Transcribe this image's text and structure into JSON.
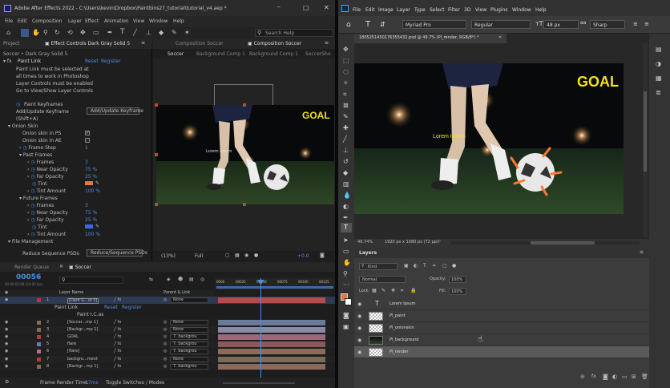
{
  "ae": {
    "title": "Adobe After Effects 2022 - C:\\Users\\kevin\\Dropbox\\Paintbins27_tutorial\\tutorial_v4.aep *",
    "menu": [
      "File",
      "Edit",
      "Composition",
      "Layer",
      "Effect",
      "Animation",
      "View",
      "Window",
      "Help"
    ],
    "search_help": "Search Help",
    "project_tab": "Project",
    "effect_controls_tab": "Effect Controls Dark Gray Solid 5",
    "fx_header": "Soccer • Dark Gray Solid 5",
    "fx_name": "Paint Link",
    "reset": "Reset",
    "register": "Register",
    "info_lines": [
      "Paint Link must be selected at",
      "all times to work in Photoshop",
      "Layer Controls must be enabled",
      "Go to View/Show Layer Controls"
    ],
    "paint_keyframes": "Paint Keyframes",
    "add_update": "Add/Update Keyframe",
    "add_update_button": "Add/Update Keyframe",
    "shift_a": "(Shift+A)",
    "onion_skin": "Onion Skin",
    "onion_ps": "Onion skin in PS",
    "onion_ae": "Onion skin in AE",
    "frame_step": "Frame Step",
    "frame_step_val": "1",
    "past_frames": "Past Frames",
    "future_frames": "Future Frames",
    "frames": "Frames",
    "frames_val": "3",
    "near_opacity": "Near Opacity",
    "near_val": "75 %",
    "far_opacity": "Far Opacity",
    "far_val": "25 %",
    "tint": "Tint",
    "tint_amount": "Tint Amount",
    "tint_amount_val": "100 %",
    "file_management": "File Management",
    "reduce_psds": "Reduce Sequence PSDs",
    "reduce_button": "Reduce/Sequence PSDs",
    "comp_panel_tab": "Composition Soccer",
    "comp_tab_inactive": "Composition Soccer",
    "comp_subtabs": [
      "Soccer",
      "Background Comp 1",
      "Background Comp 1",
      "SoccerSho"
    ],
    "goal": "GOAL",
    "lorem": "Lorem Ipsum",
    "zoom": "(13%)",
    "resolution": "Full",
    "exposure": "+0.0",
    "render_queue": "Render Queue",
    "timeline_tab": "Soccer",
    "timecode": "00056",
    "timecode_sub": "00:00:02:08 (24.00 fps)",
    "ruler": [
      "0000",
      "00025",
      "00050",
      "00075",
      "00100",
      "00125"
    ],
    "col_layer_name": "Layer Name",
    "col_parent": "Parent & Link",
    "layers": [
      {
        "num": "1",
        "name": "[Dark G...id 5]",
        "parent": "None",
        "color": "#b33a3a",
        "selected": true
      },
      {
        "num": "2",
        "name": "[Soccer...mp 1]",
        "parent": "None",
        "color": "#8a6a4a",
        "selected": false
      },
      {
        "num": "3",
        "name": "[Backgr...mp 1]",
        "parent": "None",
        "color": "#8a6a4a",
        "selected": false
      },
      {
        "num": "4",
        "name": "GOAL",
        "parent": "7. backgrou",
        "color": "#b33a3a",
        "selected": false
      },
      {
        "num": "5",
        "name": "flare",
        "parent": "7. backgrou",
        "color": "#6a7ab3",
        "selected": false
      },
      {
        "num": "6",
        "name": "[flare]",
        "parent": "7. backgrou",
        "color": "#b36a8a",
        "selected": false
      },
      {
        "num": "7",
        "name": "backgro...ment",
        "parent": "None",
        "color": "#b33a3a",
        "selected": false
      },
      {
        "num": "8",
        "name": "[Backgr...mp 1]",
        "parent": "7. backgrou",
        "color": "#8a6a4a",
        "selected": false
      }
    ],
    "paint_link": "Paint Link",
    "paint_link_sub": "Paint I.C.as",
    "frame_render_time": "Frame Render Time:",
    "frame_render_val": "17ms",
    "toggle_switches": "Toggle Switches / Modes"
  },
  "ps": {
    "menu": [
      "File",
      "Edit",
      "Image",
      "Layer",
      "Type",
      "Select",
      "Filter",
      "3D",
      "View",
      "Plugins",
      "Window",
      "Help"
    ],
    "font": "Myriad Pro",
    "style": "Regular",
    "size": "48 px",
    "aa": "Sharp",
    "doc_tab": "1805251450176355432.psd @ 49.7% (Pl_render, RGB/8*) *",
    "goal": "GOAL",
    "lorem": "Lorem Ipsum",
    "zoom": "49.74%",
    "dims": "1920 px x 1080 px (72 ppi)",
    "layers_tab": "Layers",
    "kind": "Kind",
    "blend": "Normal",
    "opacity_label": "Opacity:",
    "opacity_val": "100%",
    "lock_label": "Lock:",
    "fill_label": "Fill:",
    "fill_val": "100%",
    "layers": [
      {
        "name": "Lorem Ipsum",
        "type": "text"
      },
      {
        "name": "Pl_paint",
        "type": "pixel"
      },
      {
        "name": "Pl_onionskin",
        "type": "pixel"
      },
      {
        "name": "Pl_background",
        "type": "image"
      },
      {
        "name": "Pl_render",
        "type": "pixel",
        "selected": true
      }
    ]
  },
  "colors": {
    "ae_blue": "#4a8fe0",
    "ps_bg": "#535353",
    "goal_yellow": "#f2e21a",
    "timeline_red": "#b54b4b",
    "tint_orange": "#e07a3a",
    "tint_blue": "#3a6ae0"
  }
}
